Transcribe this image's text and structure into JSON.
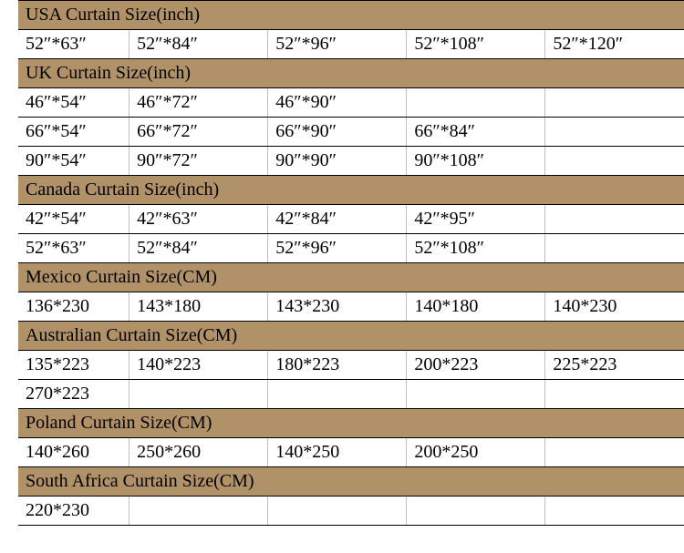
{
  "chart_data": {
    "type": "table",
    "sections": [
      {
        "header": "USA Curtain Size(inch)",
        "rows": [
          [
            "52″*63″",
            "52″*84″",
            "52″*96″",
            "52″*108″",
            "52″*120″"
          ]
        ]
      },
      {
        "header": "UK Curtain Size(inch)",
        "rows": [
          [
            "46″*54″",
            "46″*72″",
            "46″*90″",
            "",
            ""
          ],
          [
            "66″*54″",
            "66″*72″",
            "66″*90″",
            "66″*84″",
            ""
          ],
          [
            "90″*54″",
            "90″*72″",
            "90″*90″",
            "90″*108″",
            ""
          ]
        ]
      },
      {
        "header": "Canada Curtain Size(inch)",
        "rows": [
          [
            "42″*54″",
            "42″*63″",
            "42″*84″",
            "42″*95″",
            ""
          ],
          [
            "52″*63″",
            "52″*84″",
            "52″*96″",
            "52″*108″",
            ""
          ]
        ]
      },
      {
        "header": "Mexico Curtain Size(CM)",
        "rows": [
          [
            "136*230",
            "143*180",
            "143*230",
            "140*180",
            "140*230"
          ]
        ]
      },
      {
        "header": "Australian Curtain Size(CM)",
        "rows": [
          [
            "135*223",
            "140*223",
            "180*223",
            "200*223",
            "225*223"
          ],
          [
            "270*223",
            "",
            "",
            "",
            ""
          ]
        ]
      },
      {
        "header": "Poland Curtain Size(CM)",
        "rows": [
          [
            "140*260",
            "250*260",
            "140*250",
            "200*250",
            ""
          ]
        ]
      },
      {
        "header": "South Africa Curtain Size(CM)",
        "rows": [
          [
            "220*230",
            "",
            "",
            "",
            ""
          ]
        ]
      }
    ]
  }
}
